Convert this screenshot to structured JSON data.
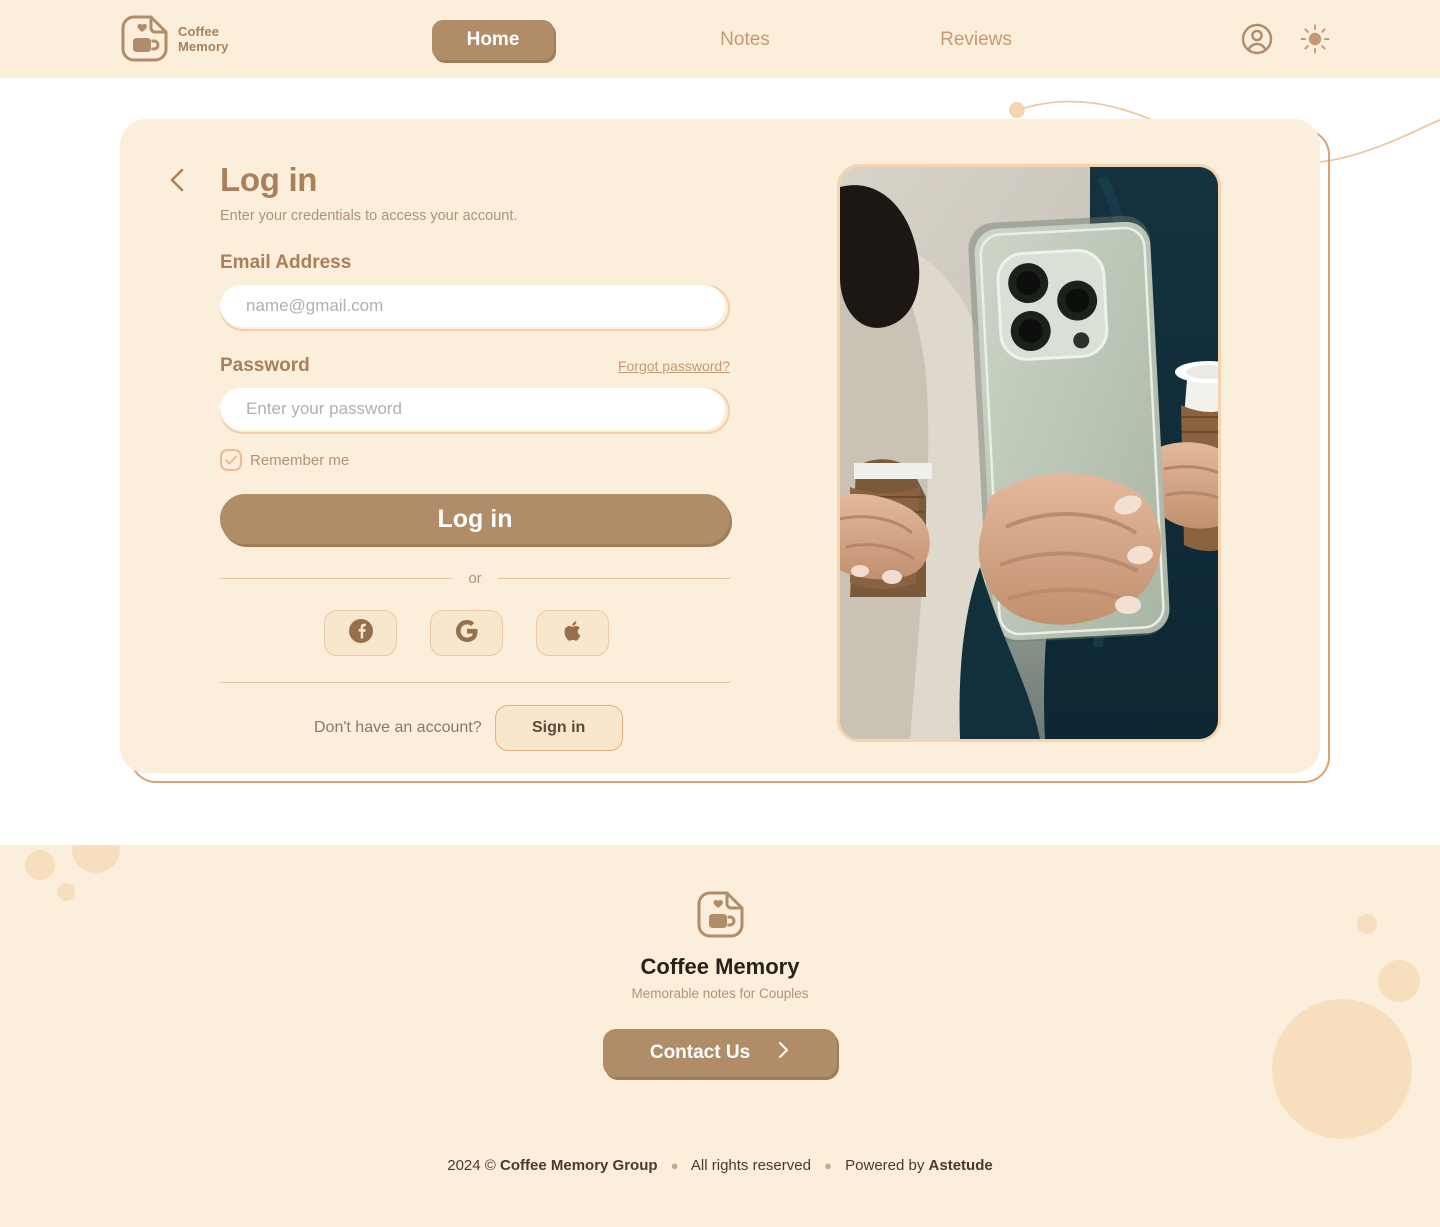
{
  "brand": {
    "name_line1": "Coffee",
    "name_line2": "Memory",
    "logo_icon": "coffee-memory-logo-icon"
  },
  "header": {
    "nav": [
      {
        "label": "Home",
        "active": true
      },
      {
        "label": "Notes",
        "active": false
      },
      {
        "label": "Reviews",
        "active": false
      }
    ],
    "account_icon": "user-account-icon",
    "theme_icon": "sun-icon"
  },
  "login": {
    "back_icon": "chevron-left-icon",
    "title": "Log in",
    "subtitle": "Enter your credentials to access your account.",
    "email_label": "Email Address",
    "email_value": "",
    "email_placeholder": "name@gmail.com",
    "password_label": "Password",
    "password_value": "",
    "password_placeholder": "Enter your password",
    "forgot_label": "Forgot password?",
    "remember_label": "Remember me",
    "remember_checked": true,
    "submit_label": "Log in",
    "divider_label": "or",
    "social": [
      {
        "name": "facebook",
        "label": "Facebook"
      },
      {
        "name": "google",
        "label": "Google"
      },
      {
        "name": "apple",
        "label": "Apple"
      }
    ],
    "signup_text": "Don't have an account?",
    "signup_button": "Sign in"
  },
  "hero": {
    "alt": "Person in navy blazer holding a smartphone between two takeaway coffee cups"
  },
  "footer": {
    "logo_icon": "coffee-memory-logo-icon",
    "title": "Coffee Memory",
    "tagline": "Memorable notes for Couples",
    "contact_label": "Contact Us",
    "contact_arrow": "chevron-right-icon",
    "copyright_year": "2024 ©",
    "copyright_company": "Coffee Memory Group",
    "copyright_rights": "All rights reserved",
    "copyright_powered_prefix": "Powered by",
    "copyright_powered_brand": "Astetude"
  },
  "colors": {
    "cream": "#fbeedb",
    "accent": "#b08d68",
    "accent_text": "#a9805a",
    "muted_text": "#b09377",
    "border": "#e0b387",
    "decor": "#f7dfbd"
  }
}
